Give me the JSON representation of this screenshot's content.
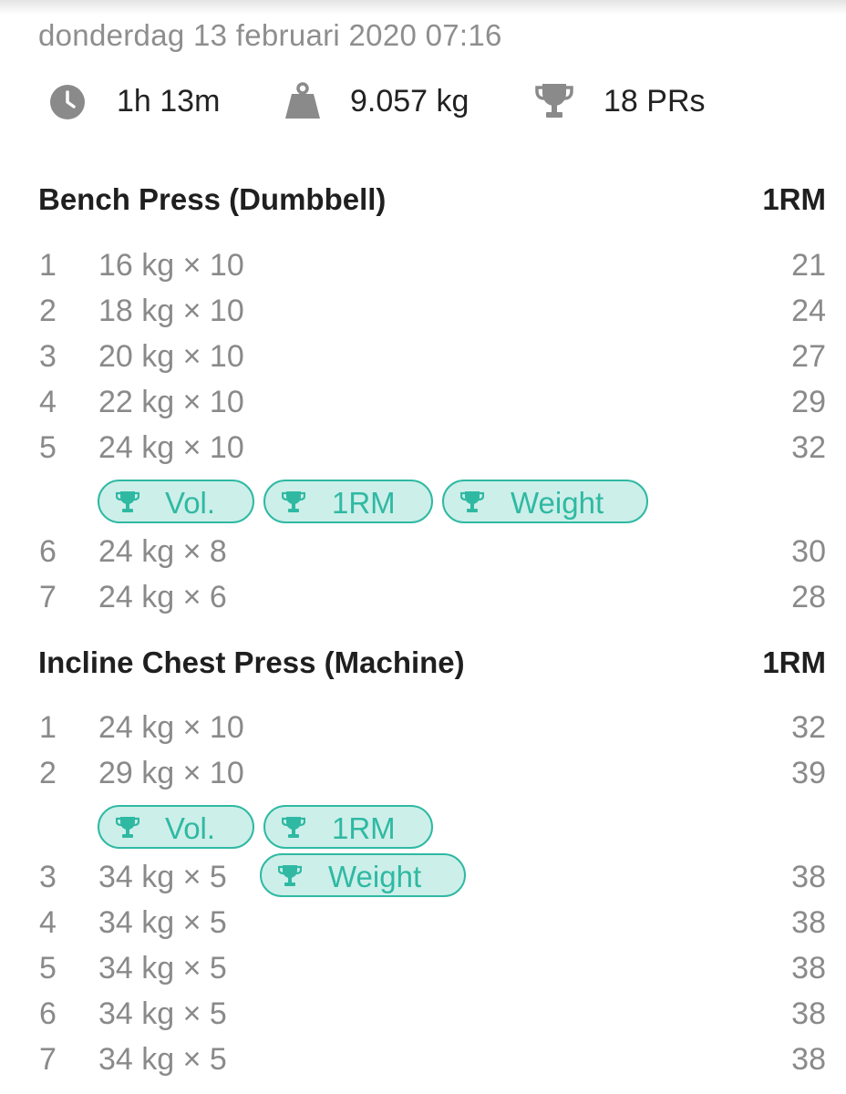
{
  "workout": {
    "date": "donderdag 13 februari 2020 07:16",
    "duration": "1h 13m",
    "volume": "9.057 kg",
    "prs": "18 PRs"
  },
  "icons": {
    "duration": "clock-icon",
    "volume": "weight-icon",
    "prs": "trophy-icon"
  },
  "colors": {
    "badge_accent": "#2fb9a3",
    "badge_fill": "#cdefe9",
    "muted_text": "#8a8a8a"
  },
  "exercises": [
    {
      "name": "Bench Press (Dumbbell)",
      "rm_header": "1RM",
      "sets": [
        {
          "num": "1",
          "value": "16 kg × 10",
          "rm": "21"
        },
        {
          "num": "2",
          "value": "18 kg × 10",
          "rm": "24"
        },
        {
          "num": "3",
          "value": "20 kg × 10",
          "rm": "27"
        },
        {
          "num": "4",
          "value": "22 kg × 10",
          "rm": "29"
        },
        {
          "num": "5",
          "value": "24 kg × 10",
          "rm": "32"
        },
        {
          "num": "6",
          "value": "24 kg × 8",
          "rm": "30"
        },
        {
          "num": "7",
          "value": "24 kg × 6",
          "rm": "28"
        }
      ],
      "badges": [
        "Vol.",
        "1RM",
        "Weight"
      ]
    },
    {
      "name": "Incline Chest Press (Machine)",
      "rm_header": "1RM",
      "sets": [
        {
          "num": "1",
          "value": "24 kg × 10",
          "rm": "32"
        },
        {
          "num": "2",
          "value": "29 kg × 10",
          "rm": "39"
        },
        {
          "num": "3",
          "value": "34 kg × 5",
          "rm": "38"
        },
        {
          "num": "4",
          "value": "34 kg × 5",
          "rm": "38"
        },
        {
          "num": "5",
          "value": "34 kg × 5",
          "rm": "38"
        },
        {
          "num": "6",
          "value": "34 kg × 5",
          "rm": "38"
        },
        {
          "num": "7",
          "value": "34 kg × 5",
          "rm": "38"
        }
      ],
      "badges": [
        "Vol.",
        "1RM",
        "Weight"
      ]
    }
  ]
}
